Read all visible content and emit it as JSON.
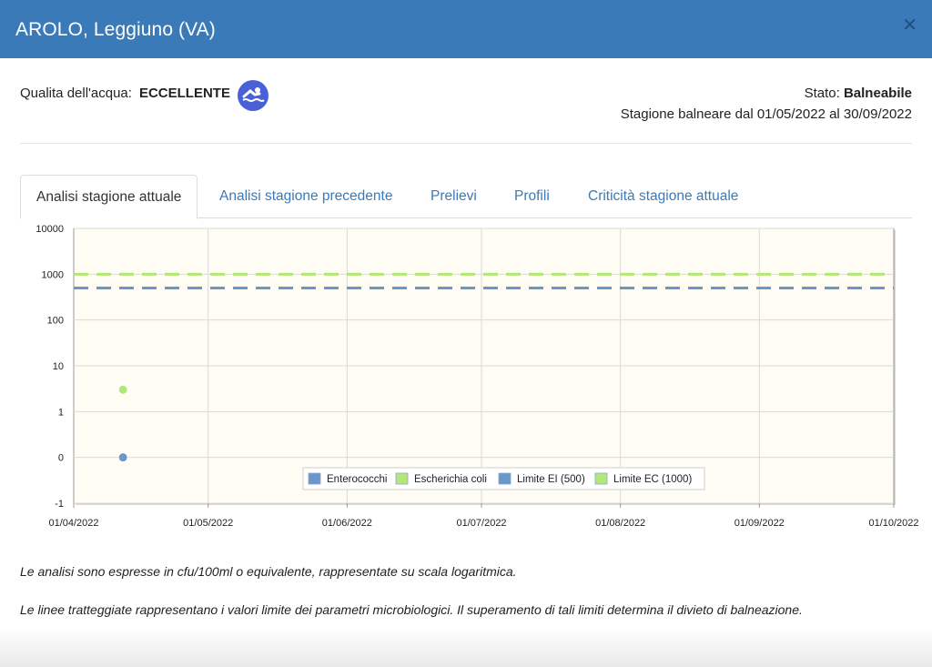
{
  "header": {
    "title": "AROLO, Leggiuno (VA)",
    "close_icon": "close-icon"
  },
  "quality": {
    "label": "Qualita dell'acqua:",
    "value": "ECCELLENTE",
    "icon": "swimmer-icon",
    "icon_color": "#4960d6"
  },
  "status": {
    "label": "Stato:",
    "value": "Balneabile",
    "season": "Stagione balneare dal 01/05/2022 al 30/09/2022"
  },
  "tabs": [
    {
      "label": "Analisi stagione attuale",
      "active": true
    },
    {
      "label": "Analisi stagione precedente",
      "active": false
    },
    {
      "label": "Prelievi",
      "active": false
    },
    {
      "label": "Profili",
      "active": false
    },
    {
      "label": "Criticità stagione attuale",
      "active": false
    }
  ],
  "chart_data": {
    "type": "scatter",
    "yscale": "log",
    "y_ticks": [
      "10000",
      "1000",
      "100",
      "10",
      "1",
      "0",
      "-1"
    ],
    "x_ticks": [
      "01/04/2022",
      "01/05/2022",
      "01/06/2022",
      "01/07/2022",
      "01/08/2022",
      "01/09/2022",
      "01/10/2022"
    ],
    "xlim": [
      "01/04/2022",
      "01/10/2022"
    ],
    "grid": true,
    "legend_position": "bottom-right",
    "series": [
      {
        "name": "Enterococchi",
        "color": "#6b96c9",
        "points": [
          {
            "x": "12/04/2022",
            "y": 0
          }
        ]
      },
      {
        "name": "Escherichia coli",
        "color": "#b4e77a",
        "points": [
          {
            "x": "12/04/2022",
            "y": 3
          }
        ]
      },
      {
        "name": "Limite EI (500)",
        "color": "#6b96c9",
        "dashed": true,
        "value": 500
      },
      {
        "name": "Limite EC (1000)",
        "color": "#b4e77a",
        "dashed": true,
        "value": 1000
      }
    ]
  },
  "notes": [
    "Le analisi sono espresse in cfu/100ml o equivalente, rappresentate su scala logaritmica.",
    "Le linee tratteggiate rappresentano i valori limite dei parametri microbiologici. Il superamento di tali limiti determina il divieto di balneazione."
  ]
}
